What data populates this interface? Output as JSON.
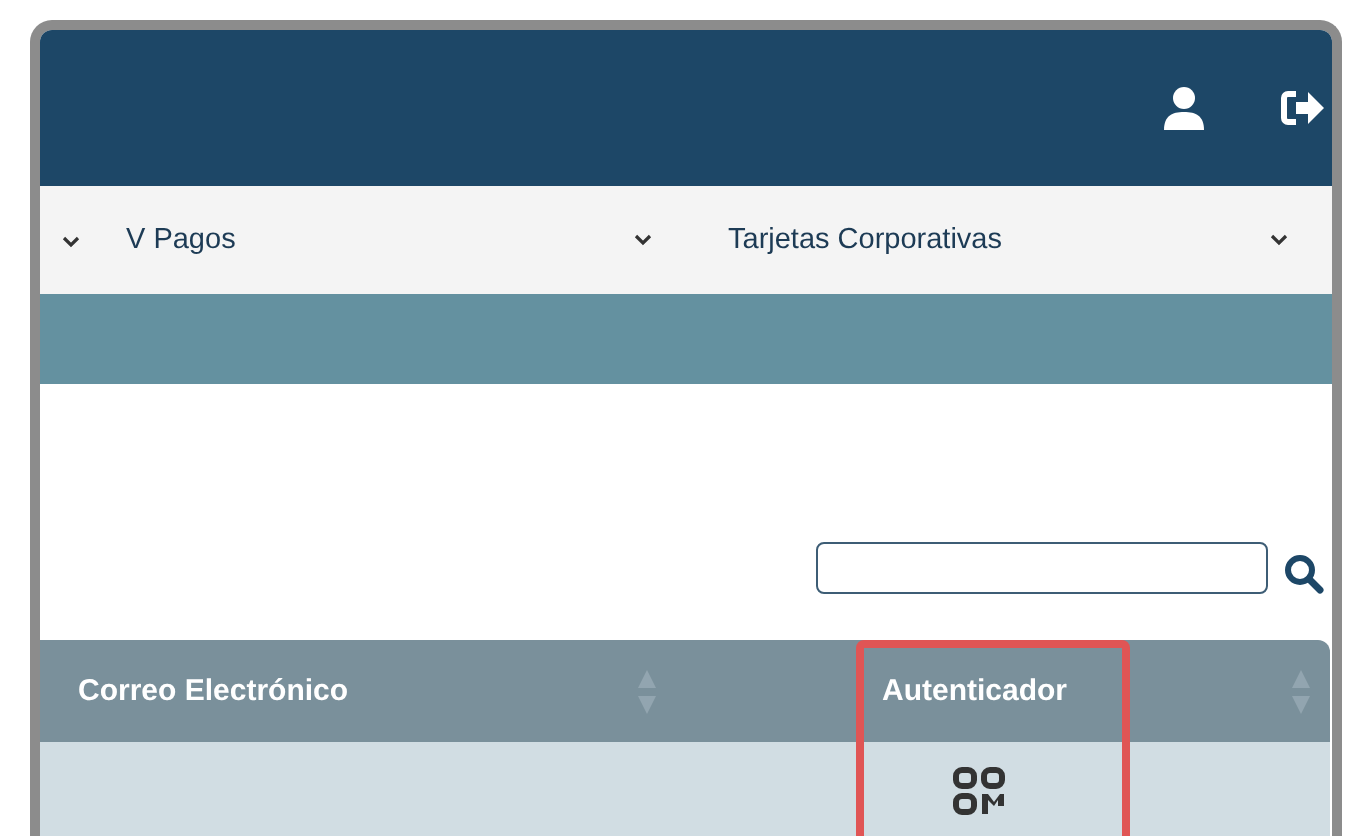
{
  "nav": {
    "items": [
      {
        "label": "V Pagos"
      },
      {
        "label": "Tarjetas Corporativas"
      }
    ]
  },
  "table": {
    "columns": [
      {
        "label": "Correo Electrónico",
        "highlighted": false
      },
      {
        "label": "Autenticador",
        "highlighted": true
      }
    ],
    "rows": [
      {
        "cells": [
          {
            "kind": "text",
            "text": ""
          },
          {
            "kind": "qr"
          }
        ]
      }
    ]
  }
}
